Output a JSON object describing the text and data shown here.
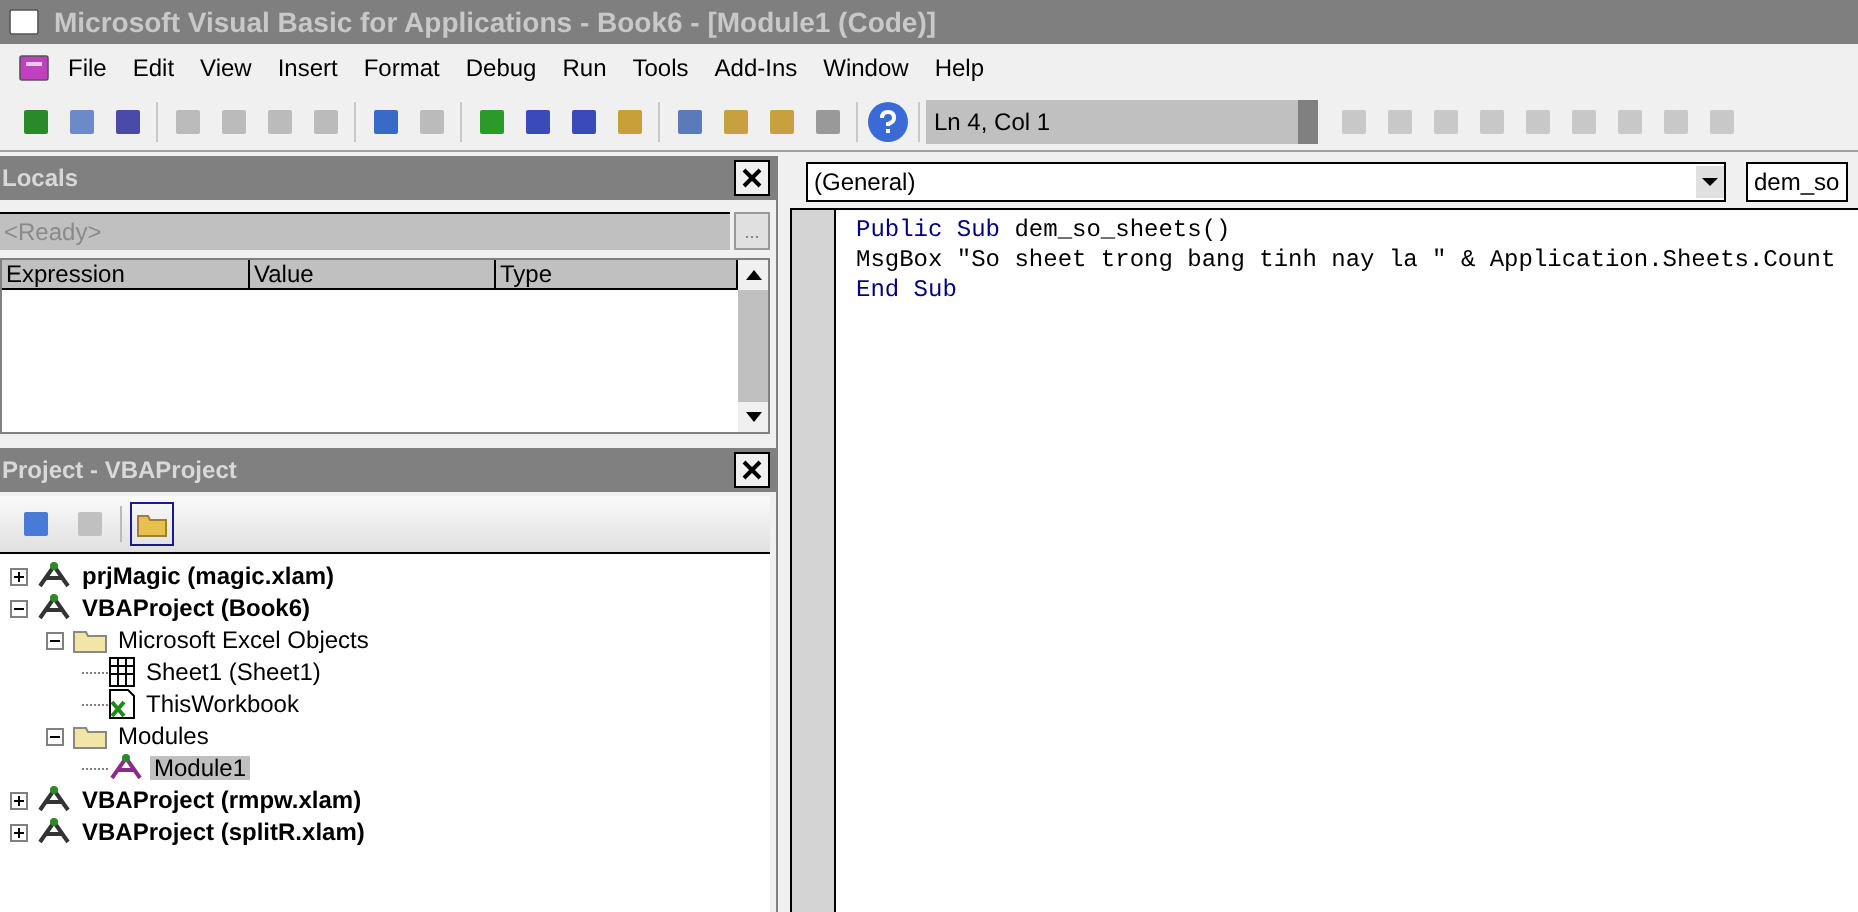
{
  "window": {
    "title": "Microsoft Visual Basic for Applications - Book6 - [Module1 (Code)]"
  },
  "menu": [
    "File",
    "Edit",
    "View",
    "Insert",
    "Format",
    "Debug",
    "Run",
    "Tools",
    "Add-Ins",
    "Window",
    "Help"
  ],
  "toolbar": {
    "position": "Ln 4, Col 1"
  },
  "locals": {
    "title": "Locals",
    "status": "<Ready>",
    "browse": "...",
    "columns": [
      "Expression",
      "Value",
      "Type"
    ]
  },
  "project": {
    "title": "Project - VBAProject",
    "tree": [
      {
        "label": "prjMagic (magic.xlam)",
        "kind": "project",
        "expanded": false,
        "selected": false
      },
      {
        "label": "VBAProject (Book6)",
        "kind": "project",
        "expanded": true,
        "selected": false,
        "children": [
          {
            "label": "Microsoft Excel Objects",
            "kind": "folder",
            "expanded": true,
            "selected": false,
            "children": [
              {
                "label": "Sheet1 (Sheet1)",
                "kind": "sheet",
                "selected": false
              },
              {
                "label": "ThisWorkbook",
                "kind": "workbook",
                "selected": false
              }
            ]
          },
          {
            "label": "Modules",
            "kind": "folder",
            "expanded": true,
            "selected": false,
            "children": [
              {
                "label": "Module1",
                "kind": "module",
                "selected": true
              }
            ]
          }
        ]
      },
      {
        "label": "VBAProject (rmpw.xlam)",
        "kind": "project",
        "expanded": false,
        "selected": false
      },
      {
        "label": "VBAProject (splitR.xlam)",
        "kind": "project",
        "expanded": false,
        "selected": false
      }
    ]
  },
  "code": {
    "object_combo": "(General)",
    "procedure_combo": "dem_so",
    "lines": [
      [
        {
          "text": "Public Sub",
          "kind": "keyword"
        },
        {
          "text": " dem_so_sheets()",
          "kind": "plain"
        }
      ],
      [
        {
          "text": "MsgBox \"So sheet trong bang tinh nay la \" & Application.Sheets.Count",
          "kind": "plain"
        }
      ],
      [
        {
          "text": "End Sub",
          "kind": "keyword"
        }
      ]
    ]
  }
}
